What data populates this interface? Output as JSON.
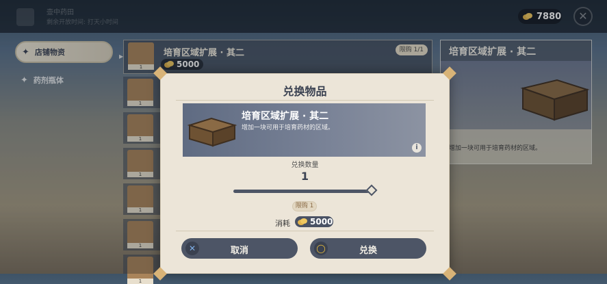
{
  "top": {
    "title": "壶中药田",
    "subtitle": "剩余开放时间: 打天小时间",
    "currency_value": "7880",
    "close_icon": "close-icon"
  },
  "sidebar": {
    "items": [
      {
        "label": "店铺物资",
        "active": true
      },
      {
        "label": "药剂瓶体",
        "active": false
      }
    ]
  },
  "list": {
    "first": {
      "name": "培育区域扩展 · 其二",
      "price": "5000",
      "limit": "限购 1/1",
      "count": "1"
    },
    "rest_counts": [
      "1",
      "1",
      "1",
      "1",
      "1",
      "1"
    ]
  },
  "detail": {
    "title": "培育区域扩展 · 其二",
    "desc": "增加一块可用于培育药材的区域。"
  },
  "dialog": {
    "title": "兑换物品",
    "item_name": "培育区域扩展 · 其二",
    "item_desc": "增加一块可用于培育药材的区域。",
    "qty_label": "兑换数量",
    "qty_value": "1",
    "quantity_fraction": 1.0,
    "limit": "限购 1",
    "cost_label": "消耗",
    "cost_value": "5000",
    "cancel_label": "取消",
    "confirm_label": "兑换"
  },
  "colors": {
    "accent_gold": "#d8b377",
    "button_dark": "#4d5566",
    "dialog_bg": "#ece5d8"
  }
}
